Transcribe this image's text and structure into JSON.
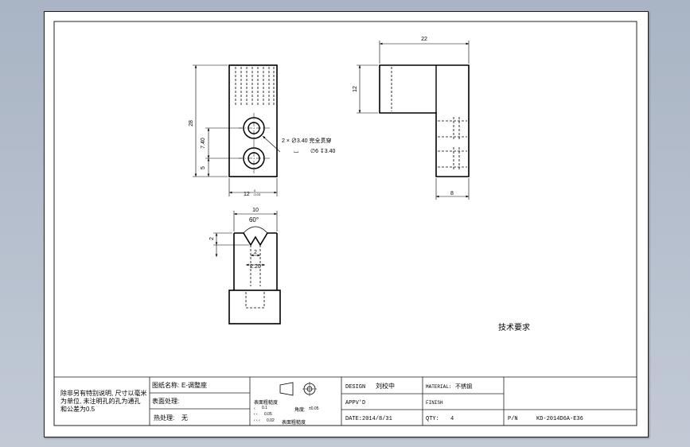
{
  "dimensions": {
    "front_height": "28",
    "hole_spacing": "7.40",
    "hole_bottom": "5",
    "front_width": "12",
    "front_width_tol_upper": "0",
    "front_width_tol_lower": "-0.03",
    "side_width": "22",
    "side_height": "12",
    "side_bottom_width": "8",
    "bottom_width": "10",
    "groove_angle": "60°",
    "groove_depth": "2",
    "groove_bottom": "2",
    "groove_top_width": "2.20"
  },
  "hole_note": {
    "line1": "2 × ∅3.40 完全贯穿",
    "line2_symbol": "⌴",
    "line2": "∅6 ↧3.40"
  },
  "tech_requirements": "技术要求",
  "title_block": {
    "notes": [
      "除非另有特别说明, 尺寸以毫米",
      "为单位, 未注明孔的孔为通孔",
      "和公差为0.5"
    ],
    "drawing_name_label": "图纸名称:",
    "drawing_name_value": "E-调整座",
    "surface_label": "表面处理:",
    "heat_label": "热处理:",
    "heat_value": "无",
    "roughness_label": "表面粗糙度",
    "roughness_values": [
      "0.1",
      "0.05",
      "0.02"
    ],
    "roughness_prefix": [
      "‹",
      "‹ ‹",
      "‹ ‹ ‹"
    ],
    "flatness_label": "角度:",
    "flatness_value": "±0.05",
    "bottom_label": "表面粗糙度",
    "design_label": "DESIGN",
    "design_value": "刘校中",
    "appvd_label": "APPV'D",
    "date_label": "DATE:",
    "date_value": "2014/8/31",
    "material_label": "MATERIAL:",
    "material_value": "不锈钢",
    "finish_label": "FINISH",
    "qty_label": "QTY:",
    "qty_value": "4",
    "pn_label": "P/N",
    "pn_value": "KD-2014D6A-E36"
  }
}
